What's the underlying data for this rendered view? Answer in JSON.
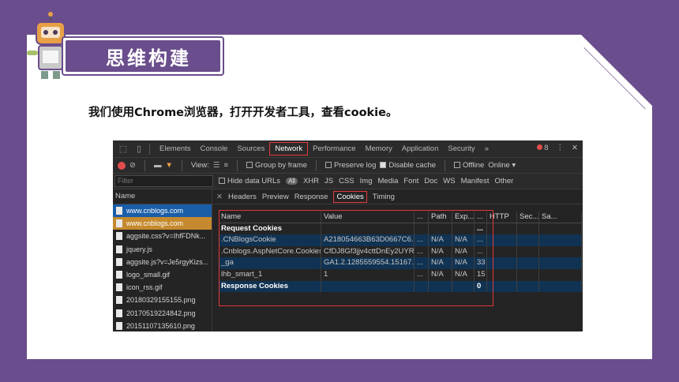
{
  "slide": {
    "title": "思维构建",
    "intro": "我们使用Chrome浏览器，打开开发者工具，查看cookie。"
  },
  "devtools": {
    "tabs": [
      "Elements",
      "Console",
      "Sources",
      "Network",
      "Performance",
      "Memory",
      "Application",
      "Security",
      "»"
    ],
    "active_tab": "Network",
    "error_count": "8",
    "toolbar": {
      "view_label": "View:",
      "group_by_frame": "Group by frame",
      "preserve_log": "Preserve log",
      "disable_cache": "Disable cache",
      "offline": "Offline",
      "online": "Online ▾"
    },
    "filter": {
      "placeholder": "Filter",
      "hide_data_urls": "Hide data URLs",
      "all_label": "All",
      "types": [
        "XHR",
        "JS",
        "CSS",
        "Img",
        "Media",
        "Font",
        "Doc",
        "WS",
        "Manifest",
        "Other"
      ]
    },
    "request_list": {
      "header": "Name",
      "items": [
        "www.cnblogs.com",
        "www.cnblogs.com",
        "aggsite.css?v=IhfFDNk...",
        "jquery.js",
        "aggsite.js?v=Je5rgyKizs...",
        "logo_small.gif",
        "icon_rss.gif",
        "20180329155155.png",
        "20170519224842.png",
        "20151107135610.png"
      ]
    },
    "detail_tabs": [
      "Headers",
      "Preview",
      "Response",
      "Cookies",
      "Timing"
    ],
    "active_detail_tab": "Cookies",
    "cookies": {
      "headers": [
        "Name",
        "Value",
        "...",
        "Path",
        "Exp...",
        "...",
        "HTTP",
        "Sec...",
        "Sa..."
      ],
      "request_group": "Request Cookies",
      "request_group_last": "...",
      "rows": [
        [
          ".CNBlogsCookie",
          "A218054663B63D0667C6...",
          "...",
          "N/A",
          "N/A",
          "..."
        ],
        [
          ".Cnblogs.AspNetCore.Cookies",
          "CfDJ8Gf3jjv4cttDnEy2UYR...",
          "...",
          "N/A",
          "N/A",
          "..."
        ],
        [
          "_ga",
          "GA1.2.1285559554.15167...",
          "...",
          "N/A",
          "N/A",
          "33"
        ],
        [
          "lhb_smart_1",
          "1",
          "...",
          "N/A",
          "N/A",
          "15"
        ]
      ],
      "response_group": "Response Cookies",
      "response_group_last": "0"
    }
  }
}
